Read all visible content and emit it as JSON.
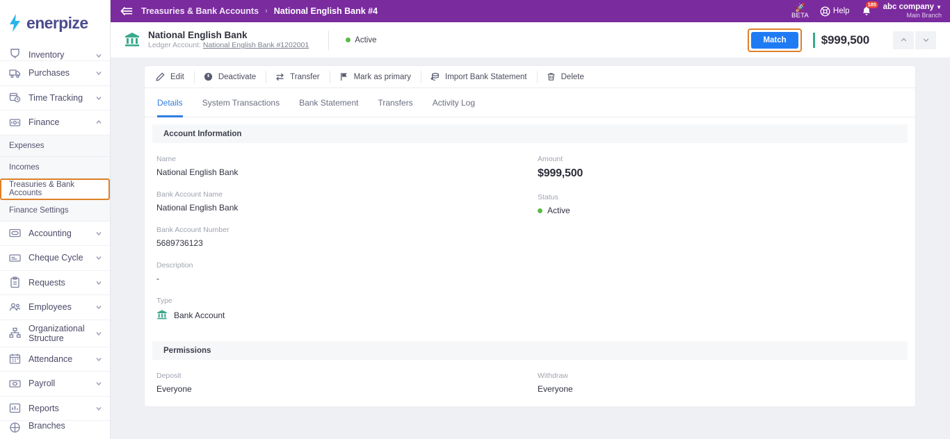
{
  "brand": {
    "name": "enerpize",
    "bolt_icon": "lightning-bolt-icon"
  },
  "sidebar": {
    "top_partial": {
      "label": "Inventory",
      "icon": "inventory-icon"
    },
    "items": [
      {
        "label": "Purchases",
        "icon": "purchases-truck-icon",
        "chevron": "chevron-down-icon"
      },
      {
        "label": "Time Tracking",
        "icon": "time-tracking-clock-icon",
        "chevron": "chevron-down-icon"
      },
      {
        "label": "Finance",
        "icon": "finance-money-icon",
        "chevron": "chevron-up-icon"
      }
    ],
    "finance_submenu": [
      {
        "label": "Expenses"
      },
      {
        "label": "Incomes"
      },
      {
        "label": "Treasuries & Bank Accounts"
      },
      {
        "label": "Finance Settings"
      }
    ],
    "items_after": [
      {
        "label": "Accounting",
        "icon": "accounting-icon",
        "chevron": "chevron-down-icon"
      },
      {
        "label": "Cheque Cycle",
        "icon": "cheque-icon",
        "chevron": "chevron-down-icon"
      },
      {
        "label": "Requests",
        "icon": "requests-clipboard-icon",
        "chevron": "chevron-down-icon"
      },
      {
        "label": "Employees",
        "icon": "employees-icon",
        "chevron": "chevron-down-icon"
      },
      {
        "label": "Organizational Structure",
        "icon": "org-structure-icon",
        "chevron": "chevron-down-icon"
      },
      {
        "label": "Attendance",
        "icon": "attendance-calendar-icon",
        "chevron": "chevron-down-icon"
      },
      {
        "label": "Payroll",
        "icon": "payroll-icon",
        "chevron": "chevron-down-icon"
      },
      {
        "label": "Reports",
        "icon": "reports-bar-icon",
        "chevron": "chevron-down-icon"
      }
    ],
    "bottom_partial": {
      "label": "Branches",
      "icon": "branches-icon"
    },
    "highlight_color": "#e08128"
  },
  "topbar": {
    "collapse_icon": "collapse-sidebar-icon",
    "background": "#7a2b9e",
    "breadcrumb": [
      {
        "label": "Treasuries & Bank Accounts",
        "active": false
      },
      {
        "label": "National English Bank #4",
        "active": true
      }
    ],
    "separator": "›",
    "beta": {
      "icon": "rocket-icon",
      "label": "BETA"
    },
    "help": {
      "icon": "help-lifebuoy-icon",
      "label": "Help"
    },
    "notifications": {
      "icon": "bell-icon",
      "count": "185"
    },
    "account": {
      "company": "abc company",
      "branch": "Main Branch",
      "chevron": "chevron-down-icon"
    }
  },
  "page_header": {
    "icon": "bank-building-icon",
    "title": "National English Bank",
    "ledger_prefix": "Ledger Account: ",
    "ledger_link": "National English Bank #1202001",
    "status": {
      "label": "Active",
      "color": "#5cba47"
    },
    "match_button": "Match",
    "amount": "$999,500",
    "amount_accent": "#3aa98c",
    "prev_icon": "chevron-up-icon",
    "next_icon": "chevron-down-icon"
  },
  "toolbar": [
    {
      "label": "Edit",
      "icon": "pencil-edit-icon"
    },
    {
      "label": "Deactivate",
      "icon": "power-circle-icon"
    },
    {
      "label": "Transfer",
      "icon": "transfer-arrows-icon"
    },
    {
      "label": "Mark as primary",
      "icon": "flag-icon"
    },
    {
      "label": "Import Bank Statement",
      "icon": "import-stack-icon"
    },
    {
      "label": "Delete",
      "icon": "trash-icon"
    }
  ],
  "tabs": [
    {
      "label": "Details",
      "active": true
    },
    {
      "label": "System Transactions",
      "active": false
    },
    {
      "label": "Bank Statement",
      "active": false
    },
    {
      "label": "Transfers",
      "active": false
    },
    {
      "label": "Activity Log",
      "active": false
    }
  ],
  "account_information": {
    "section_title": "Account Information",
    "left": [
      {
        "label": "Name",
        "value": "National English Bank"
      },
      {
        "label": "Bank Account Name",
        "value": "National English Bank"
      },
      {
        "label": "Bank Account Number",
        "value": "5689736123"
      },
      {
        "label": "Description",
        "value": "-"
      },
      {
        "label": "Type",
        "value": "Bank Account",
        "icon": "bank-building-icon"
      }
    ],
    "right": [
      {
        "label": "Amount",
        "value": "$999,500"
      },
      {
        "label": "Status",
        "value": "Active"
      }
    ]
  },
  "permissions": {
    "section_title": "Permissions",
    "deposit_label": "Deposit",
    "deposit_value": "Everyone",
    "withdraw_label": "Withdraw",
    "withdraw_value": "Everyone"
  }
}
